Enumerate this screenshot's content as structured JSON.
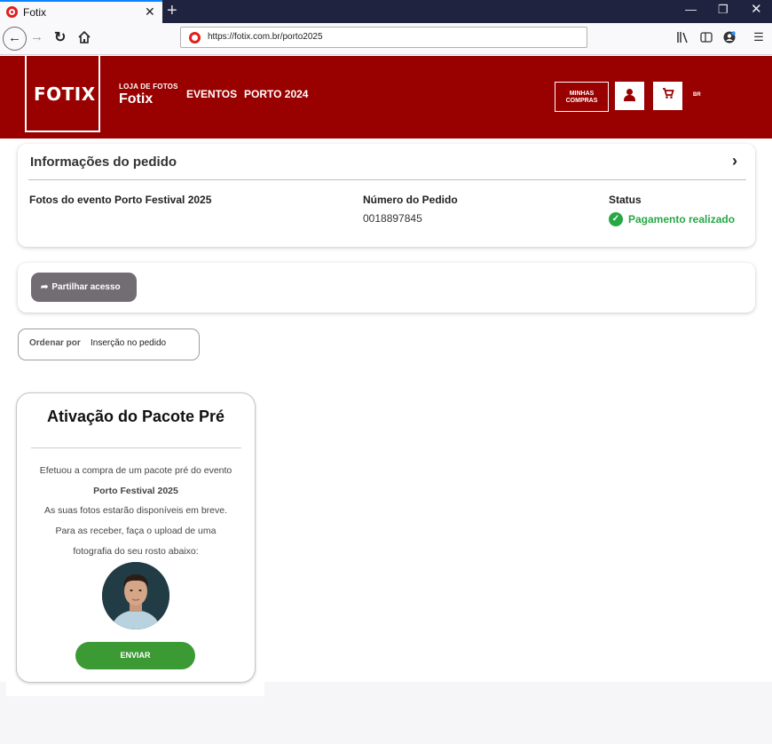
{
  "browser": {
    "tab_title": "Fotix",
    "tab_close": "✕",
    "new_tab": "+",
    "url": "https://fotix.com.br/porto2025"
  },
  "header": {
    "logo": "FOTIX",
    "store_small": "LOJA DE FOTOS",
    "store_name": "Fotix",
    "nav": [
      "EVENTOS",
      "PORTO 2024"
    ],
    "purchases_line1": "MINHAS",
    "purchases_line2": "COMPRAS",
    "lang": "BR",
    "brand_color": "#990000"
  },
  "order": {
    "title": "Informações do pedido",
    "event_label": "Fotos do evento Porto Festival 2025",
    "number_label": "Número do Pedido",
    "number_value": "0018897845",
    "status_label": "Status",
    "status_value": "Pagamento realizado",
    "status_color": "#28a745"
  },
  "share": {
    "label": "Partilhar acesso"
  },
  "sort": {
    "label": "Ordenar por",
    "value": "Inserção no pedido"
  },
  "package": {
    "title": "Ativação do Pacote Pré",
    "line1": "Efetuou a compra de um pacote pré do evento",
    "event": "Porto Festival 2025",
    "line3": "As suas fotos estarão disponíveis em breve.",
    "line4": "Para as receber, faça o upload de uma",
    "line5": "fotografia do seu rosto abaixo:",
    "button": "ENVIAR",
    "button_color": "#3c9a35"
  }
}
